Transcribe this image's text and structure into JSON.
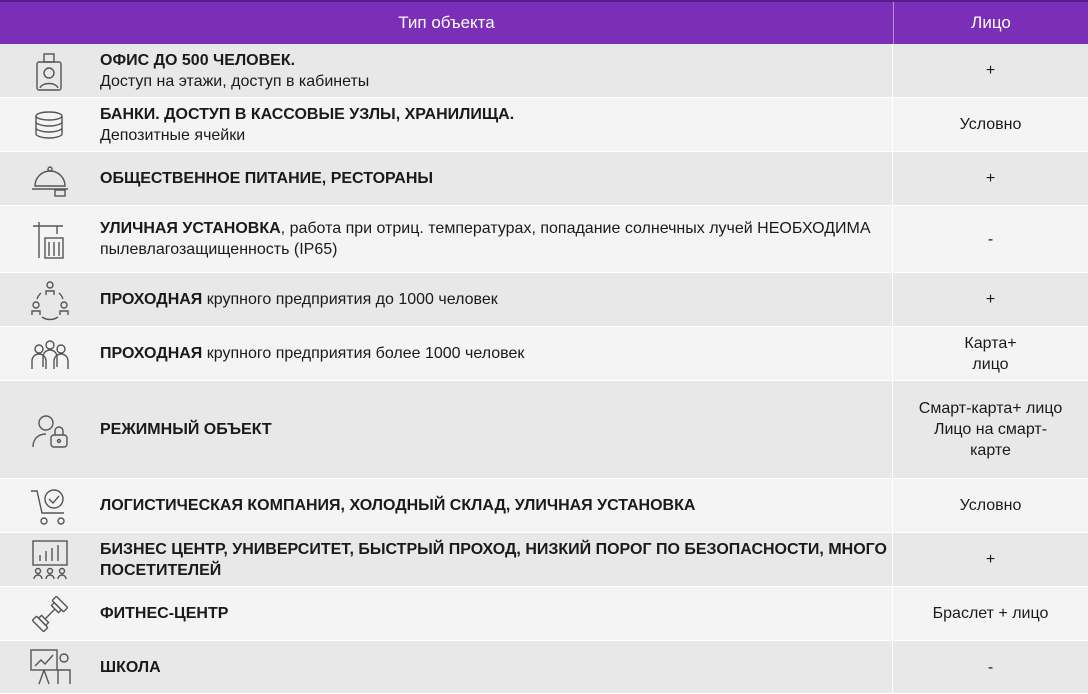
{
  "header": {
    "type_label": "Тип объекта",
    "face_label": "Лицо"
  },
  "rows": [
    {
      "icon": "badge-person-icon",
      "title": "ОФИС ДО 500 ЧЕЛОВЕК.",
      "desc": "Доступ на этажи, доступ в кабинеты",
      "value": "+"
    },
    {
      "icon": "coin-stack-icon",
      "title": "БАНКИ. ДОСТУП В КАССОВЫЕ УЗЛЫ, ХРАНИЛИЩА.",
      "desc": "Депозитные ячейки",
      "value": "Условно"
    },
    {
      "icon": "food-cloche-icon",
      "title": "ОБЩЕСТВЕННОЕ ПИТАНИЕ, РЕСТОРАНЫ",
      "desc": "",
      "value": "+"
    },
    {
      "icon": "crane-building-icon",
      "title": "УЛИЧНАЯ УСТАНОВКА",
      "desc": ", работа при отриц. температурах, попадание солнечных лучей НЕОБХОДИМА пылевлагозащищенность  (IP65)",
      "value": "-"
    },
    {
      "icon": "people-cycle-icon",
      "title": "ПРОХОДНАЯ",
      "desc": " крупного предприятия до 1000 человек",
      "value": "+"
    },
    {
      "icon": "people-group-icon",
      "title": "ПРОХОДНАЯ",
      "desc": " крупного предприятия более 1000 человек",
      "value": "Карта+\nлицо"
    },
    {
      "icon": "person-lock-icon",
      "title": "РЕЖИМНЫЙ ОБЪЕКТ",
      "desc": "",
      "value": "Смарт-карта+ лицо\nЛицо на смарт-\nкарте"
    },
    {
      "icon": "cart-check-icon",
      "title": "ЛОГИСТИЧЕСКАЯ КОМПАНИЯ, ХОЛОДНЫЙ СКЛАД, УЛИЧНАЯ УСТАНОВКА",
      "desc": "",
      "value": "Условно"
    },
    {
      "icon": "presentation-audience-icon",
      "title": "БИЗНЕС ЦЕНТР, УНИВЕРСИТЕТ, БЫСТРЫЙ ПРОХОД, НИЗКИЙ ПОРОГ ПО БЕЗОПАСНОСТИ, МНОГО ПОСЕТИТЕЛЕЙ",
      "desc": "",
      "value": "+"
    },
    {
      "icon": "dumbbell-icon",
      "title": "ФИТНЕС-ЦЕНТР",
      "desc": "",
      "value": "Браслет + лицо"
    },
    {
      "icon": "teacher-board-icon",
      "title": "ШКОЛА",
      "desc": "",
      "value": "-"
    }
  ],
  "colors": {
    "header_bg": "#7b2fb8",
    "row_odd": "#e8e8e8",
    "row_even": "#f4f4f4"
  }
}
